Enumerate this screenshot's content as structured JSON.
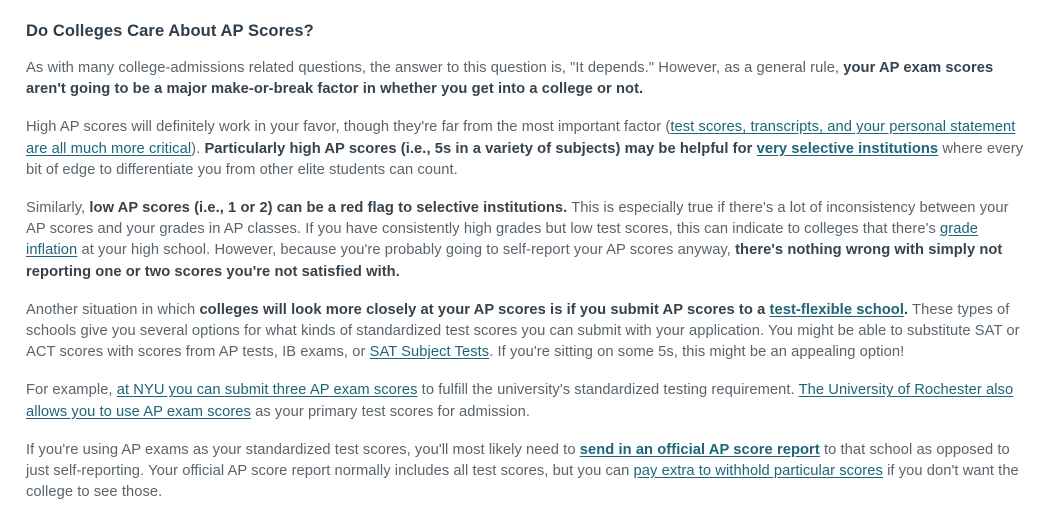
{
  "article": {
    "heading": "Do Colleges Care About AP Scores?",
    "paragraphs": [
      {
        "id": "p1",
        "segments": [
          {
            "type": "text",
            "text": "As with many college-admissions related questions, the answer to this question is, \"It depends.\" However, as a general rule, "
          },
          {
            "type": "bold",
            "text": "your AP exam scores aren't going to be a major make-or-break factor in whether you get into a college or not."
          }
        ]
      },
      {
        "id": "p2",
        "segments": [
          {
            "type": "text",
            "text": "High AP scores will definitely work in your favor, though they're far from the most important factor ("
          },
          {
            "type": "link",
            "text": "test scores, transcripts, and your personal statement are all much more critical"
          },
          {
            "type": "text",
            "text": "). "
          },
          {
            "type": "bold",
            "text": "Particularly high AP scores (i.e., 5s in a variety of subjects) may be helpful for "
          },
          {
            "type": "bold-link",
            "text": "very selective institutions"
          },
          {
            "type": "text",
            "text": " where every bit of edge to differentiate you from other elite students can count."
          }
        ]
      },
      {
        "id": "p3",
        "segments": [
          {
            "type": "text",
            "text": "Similarly, "
          },
          {
            "type": "bold",
            "text": "low AP scores (i.e., 1 or 2) can be a red flag to selective institutions."
          },
          {
            "type": "text",
            "text": " This is especially true if there's a lot of inconsistency between your AP scores and your grades in AP classes. If you have consistently high grades but low test scores, this can indicate to colleges that there's "
          },
          {
            "type": "link",
            "text": "grade inflation"
          },
          {
            "type": "text",
            "text": " at your high school. However, because you're probably going to self-report your AP scores anyway, "
          },
          {
            "type": "bold",
            "text": "there's nothing wrong with simply not reporting one or two scores you're not satisfied with."
          }
        ]
      },
      {
        "id": "p4",
        "segments": [
          {
            "type": "text",
            "text": "Another situation in which "
          },
          {
            "type": "bold",
            "text": "colleges will look more closely at your AP scores is if you submit AP scores to a "
          },
          {
            "type": "bold-link",
            "text": "test-flexible school"
          },
          {
            "type": "bold",
            "text": "."
          },
          {
            "type": "text",
            "text": " These types of schools give you several options for what kinds of standardized test scores you can submit with your application. You might be able to substitute SAT or ACT scores with scores from AP tests, IB exams, or "
          },
          {
            "type": "link",
            "text": "SAT Subject Tests"
          },
          {
            "type": "text",
            "text": ". If you're sitting on some 5s, this might be an appealing option!"
          }
        ]
      },
      {
        "id": "p5",
        "segments": [
          {
            "type": "text",
            "text": "For example, "
          },
          {
            "type": "link",
            "text": "at NYU you can submit three AP exam scores"
          },
          {
            "type": "text",
            "text": " to fulfill the university's standardized testing requirement. "
          },
          {
            "type": "link",
            "text": "The University of Rochester also allows you to use AP exam scores"
          },
          {
            "type": "text",
            "text": " as your primary test scores for admission."
          }
        ]
      },
      {
        "id": "p6",
        "segments": [
          {
            "type": "text",
            "text": "If you're using AP exams as your standardized test scores, you'll most likely need to "
          },
          {
            "type": "bold-link",
            "text": "send in an official AP score report"
          },
          {
            "type": "text",
            "text": " to that school as opposed to just self-reporting. Your official AP score report normally includes all test scores, but you can "
          },
          {
            "type": "link",
            "text": "pay extra to withhold particular scores"
          },
          {
            "type": "text",
            "text": " if you don't want the college to see those."
          }
        ]
      }
    ]
  },
  "colors": {
    "heading": "#2e3d49",
    "body_text": "#59646d",
    "bold_text": "#36424c",
    "link": "#1d6579",
    "background": "#ffffff"
  }
}
